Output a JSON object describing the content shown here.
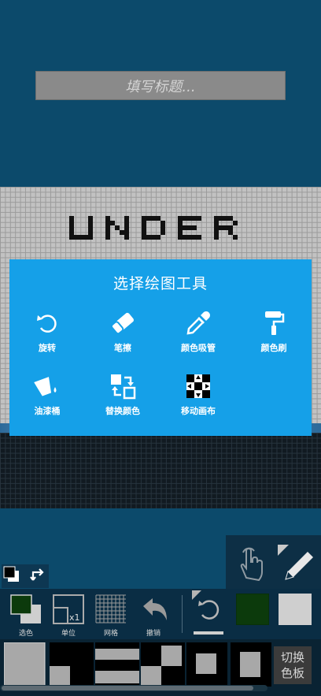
{
  "title_input": {
    "placeholder": "填写标题..."
  },
  "canvas": {
    "pixel_text": "UNDER"
  },
  "dialog": {
    "title": "选择绘图工具",
    "tools": [
      {
        "label": "旋转",
        "icon": "rotate-icon"
      },
      {
        "label": "笔擦",
        "icon": "eraser-icon"
      },
      {
        "label": "颜色吸管",
        "icon": "eyedropper-icon"
      },
      {
        "label": "颜色刷",
        "icon": "paint-roller-icon"
      },
      {
        "label": "油漆桶",
        "icon": "paint-bucket-icon"
      },
      {
        "label": "替换颜色",
        "icon": "replace-color-icon"
      },
      {
        "label": "移动画布",
        "icon": "move-canvas-icon"
      }
    ]
  },
  "toolbar": {
    "select_color": "选色",
    "unit": "单位",
    "unit_value": "x1",
    "grid": "网格",
    "undo": "撤销"
  },
  "palette": {
    "switch_label": "切换色板"
  },
  "colors": {
    "background": "#0c4a6b",
    "dialog": "#15a0e8",
    "selected_color": "#0c3a0c",
    "secondary_color": "#cfcfcf"
  }
}
